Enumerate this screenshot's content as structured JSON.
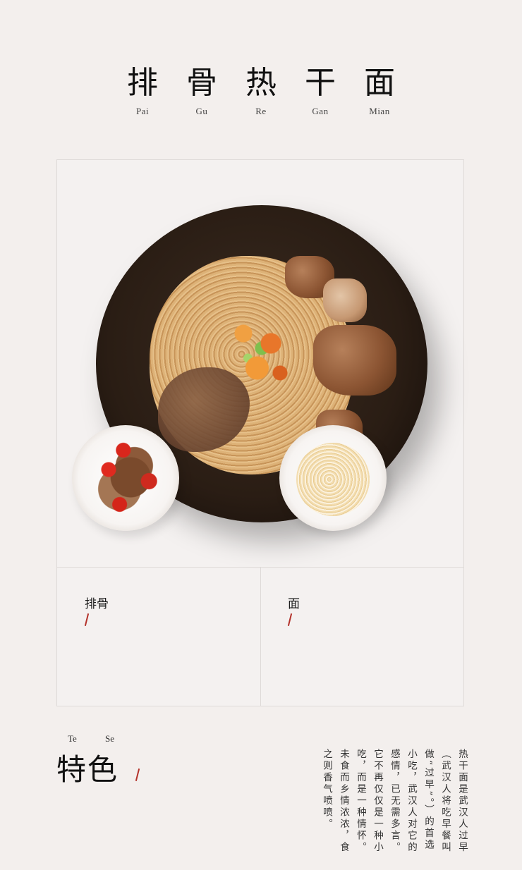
{
  "title": {
    "chars": [
      {
        "han": "排",
        "pinyin": "Pai"
      },
      {
        "han": "骨",
        "pinyin": "Gu"
      },
      {
        "han": "热",
        "pinyin": "Re"
      },
      {
        "han": "干",
        "pinyin": "Gan"
      },
      {
        "han": "面",
        "pinyin": "Mian"
      }
    ]
  },
  "panels": {
    "left_label": "排骨",
    "right_label": "面"
  },
  "feature": {
    "pinyin_1": "Te",
    "pinyin_2": "Se",
    "heading": "特色",
    "body": "热干面是武汉人过早（武汉人将吃早餐叫做“过早”。）的首选小吃，武汉人对它的感情，已无需多言。它不再仅仅是一种小吃，而是一种情怀。未食而乡情浓浓，食之则香气喷喷。"
  },
  "colors": {
    "background": "#f3efed",
    "accent_slash": "#b3322a",
    "border": "#dedad8"
  }
}
